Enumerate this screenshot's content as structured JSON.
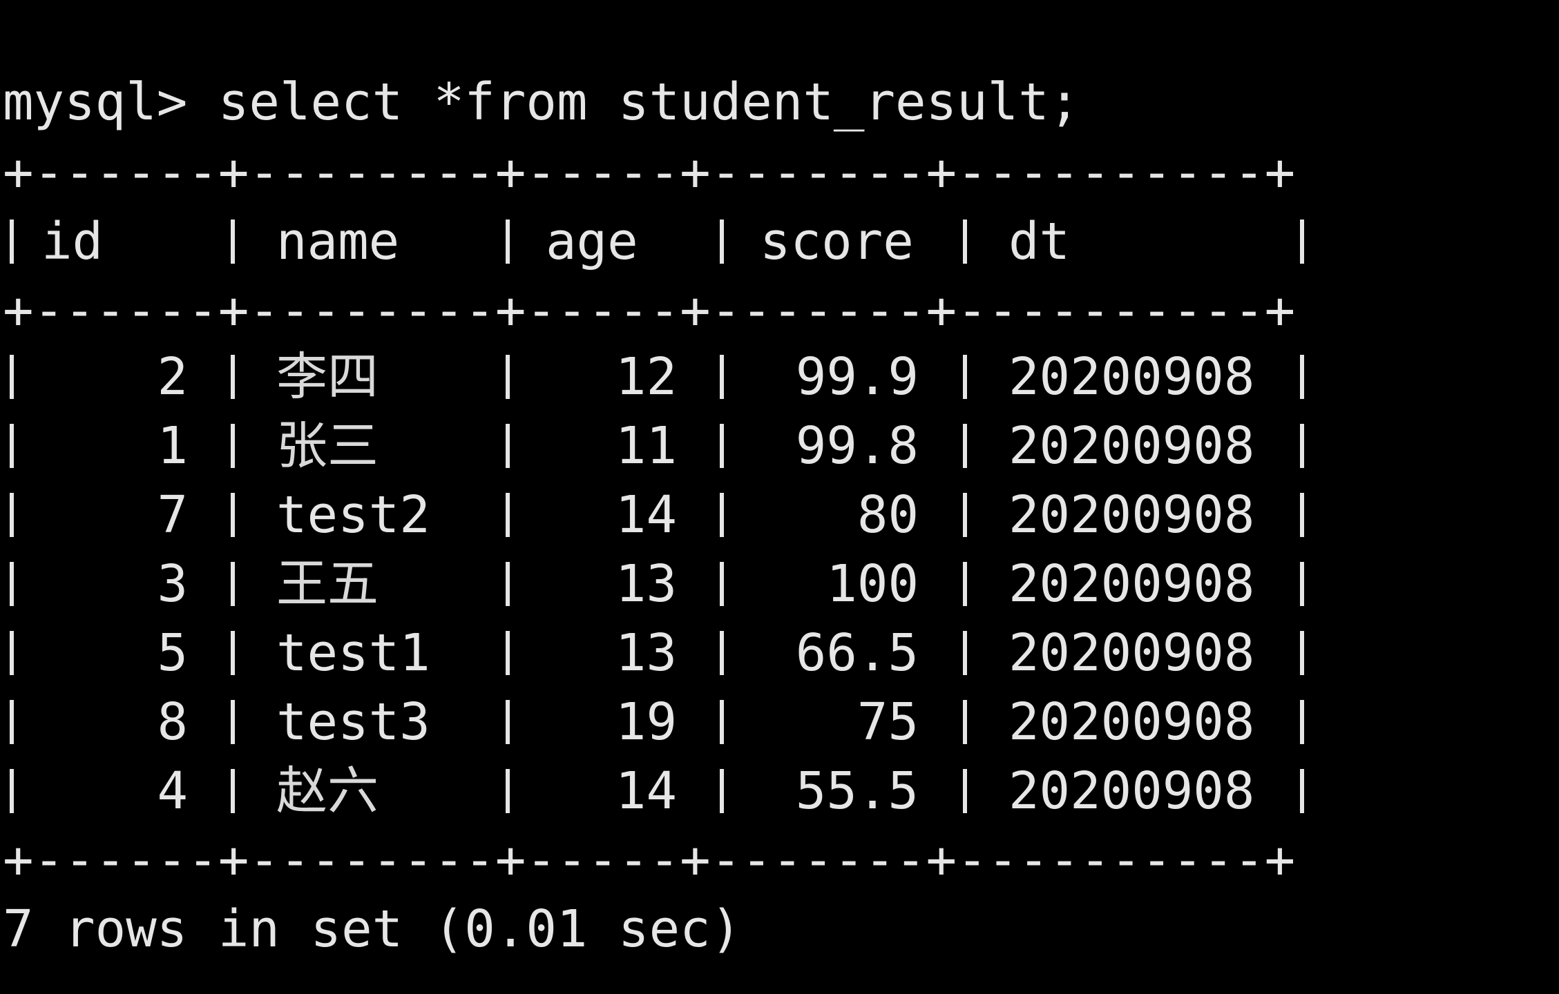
{
  "terminal": {
    "prompt": "mysql>",
    "command": "select *from student_result;",
    "border": "+------+--------+-----+-------+----------+",
    "columns": [
      "id",
      "name",
      "age",
      "score",
      "dt"
    ],
    "rows": [
      {
        "id": "2",
        "name": "李四",
        "age": "12",
        "score": "99.9",
        "dt": "20200908"
      },
      {
        "id": "1",
        "name": "张三",
        "age": "11",
        "score": "99.8",
        "dt": "20200908"
      },
      {
        "id": "7",
        "name": "test2",
        "age": "14",
        "score": "80",
        "dt": "20200908"
      },
      {
        "id": "3",
        "name": "王五",
        "age": "13",
        "score": "100",
        "dt": "20200908"
      },
      {
        "id": "5",
        "name": "test1",
        "age": "13",
        "score": "66.5",
        "dt": "20200908"
      },
      {
        "id": "8",
        "name": "test3",
        "age": "19",
        "score": "75",
        "dt": "20200908"
      },
      {
        "id": "4",
        "name": "赵六",
        "age": "14",
        "score": "55.5",
        "dt": "20200908"
      }
    ],
    "footer": "7 rows in set (0.01 sec)",
    "colors": {
      "background": "#000000",
      "foreground": "#e6e6e6"
    }
  }
}
